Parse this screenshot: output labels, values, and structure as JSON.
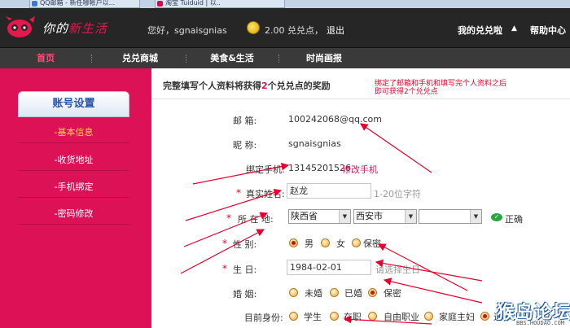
{
  "browser": {
    "tabs": [
      {
        "label": "QQ邮箱 - 新任哪帐户以...",
        "favicon_color": "#3b78d6"
      },
      {
        "label": "淘宝  Tuiduid | 以..",
        "favicon_color": "#e5004f"
      }
    ]
  },
  "header": {
    "logo_text_a": "你的",
    "logo_text_b": "新生活",
    "greeting": "您好，sgnaisgnias",
    "coins": "2.00 兑兑点，",
    "logout": "退出",
    "my_menu": "我的兑兑啦",
    "help": "帮助中心"
  },
  "nav": {
    "items": [
      "首页",
      "兑兑商城",
      "美食&生活",
      "时尚画报"
    ],
    "active_index": 0
  },
  "sidebar": {
    "title": "账号设置",
    "items": [
      "-基本信息",
      "-收货地址",
      "-手机绑定",
      "-密码修改"
    ],
    "active_index": 0
  },
  "content": {
    "head_a": "完整填写个人资料将获得",
    "head_num": "2",
    "head_b": "个兑兑点的奖励",
    "note_line1": "绑定了邮箱和手机和填写完个人资料之后",
    "note_line2": "即可获得2个兑兑点"
  },
  "form": {
    "email": {
      "label": "邮        箱:",
      "value": "100242068@qq.com"
    },
    "nickname": {
      "label": "昵        称:",
      "value": "sgnaisgnias"
    },
    "phone": {
      "label": "绑定手机:",
      "value": "13145201526",
      "link": "修改手机"
    },
    "realname": {
      "label": "真实姓名:",
      "value": "赵龙",
      "hint": "1-20位字符"
    },
    "location": {
      "label": "所  在  地:",
      "province": "陕西省",
      "city": "西安市",
      "district": "",
      "ok": "正确"
    },
    "gender": {
      "label": "性        别:",
      "options": [
        "男",
        "女",
        "保密"
      ],
      "selected": 0
    },
    "birthday": {
      "label": "生        日:",
      "value": "1984-02-01",
      "hint": "请选择生日"
    },
    "marital": {
      "label": "婚        姻:",
      "options": [
        "未婚",
        "已婚",
        "保密"
      ],
      "selected": 2
    },
    "identity": {
      "label": "目前身份:",
      "options": [
        "学生",
        "在职",
        "自由职业",
        "家庭主妇",
        "退休"
      ],
      "selected": 4
    }
  },
  "watermark": {
    "text": "猴岛论坛",
    "url": "BBS.HOUDAO.COM"
  },
  "colors": {
    "brand": "#dd1155",
    "header_bg": "#262626",
    "nav_bg": "#3a3a3a",
    "annotation": "#e5002d"
  }
}
